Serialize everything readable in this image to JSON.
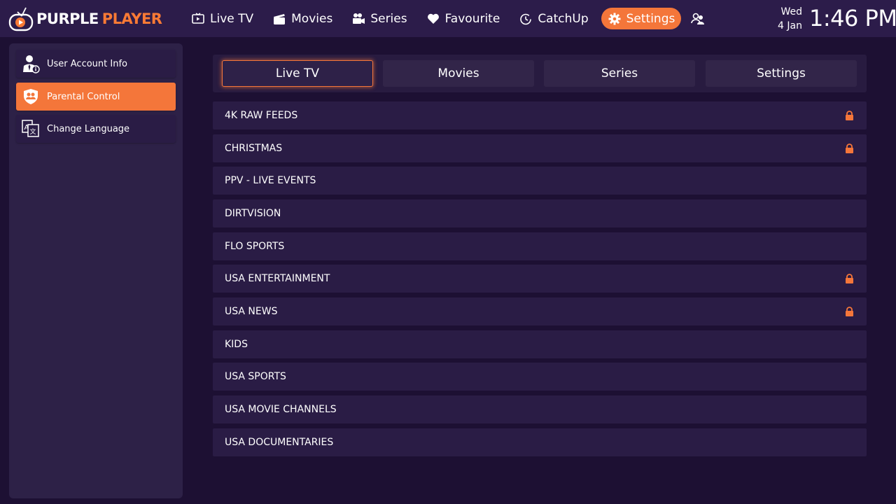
{
  "app": {
    "logo_word1": "PURPLE",
    "logo_word2": "PLAYER"
  },
  "nav": {
    "items": [
      {
        "label": "Live TV",
        "icon": "tv-icon"
      },
      {
        "label": "Movies",
        "icon": "clapperboard-icon"
      },
      {
        "label": "Series",
        "icon": "camera-icon"
      },
      {
        "label": "Favourite",
        "icon": "heart-icon"
      },
      {
        "label": "CatchUp",
        "icon": "clock-icon"
      },
      {
        "label": "Settings",
        "icon": "gear-icon",
        "active": true
      }
    ],
    "user_icon": "users-icon"
  },
  "datetime": {
    "day": "Wed",
    "date": "4 Jan",
    "time": "1:46 PM"
  },
  "sidebar": {
    "items": [
      {
        "label": "User Account Info",
        "icon": "user-info-icon"
      },
      {
        "label": "Parental Control",
        "icon": "shield-users-icon",
        "active": true
      },
      {
        "label": "Change Language",
        "icon": "translate-icon"
      }
    ]
  },
  "tabs": [
    {
      "label": "Live TV",
      "active": true
    },
    {
      "label": "Movies"
    },
    {
      "label": "Series"
    },
    {
      "label": "Settings"
    }
  ],
  "categories": [
    {
      "name": "4K RAW FEEDS",
      "locked": true
    },
    {
      "name": "CHRISTMAS",
      "locked": true
    },
    {
      "name": "PPV - LIVE EVENTS",
      "locked": false
    },
    {
      "name": "DIRTVISION",
      "locked": false
    },
    {
      "name": "FLO SPORTS",
      "locked": false
    },
    {
      "name": "USA ENTERTAINMENT",
      "locked": true
    },
    {
      "name": "USA NEWS",
      "locked": true
    },
    {
      "name": "KIDS",
      "locked": false
    },
    {
      "name": "USA SPORTS",
      "locked": false
    },
    {
      "name": "USA MOVIE CHANNELS",
      "locked": false
    },
    {
      "name": "USA DOCUMENTARIES",
      "locked": false
    }
  ],
  "colors": {
    "accent": "#f4763a",
    "background": "#1d1033",
    "panel": "#2a1c45"
  }
}
